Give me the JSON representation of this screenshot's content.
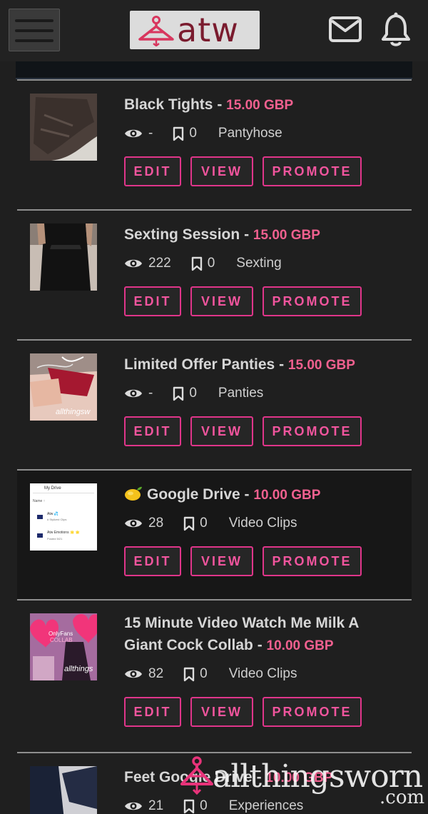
{
  "header": {
    "logo_text": "atw",
    "menu_icon": "hamburger-icon",
    "mail_icon": "mail-icon",
    "bell_icon": "bell-icon"
  },
  "listings": [
    {
      "title": "Black Tights",
      "separator": "-",
      "price": "15.00 GBP",
      "views": "-",
      "saves": "0",
      "category": "Pantyhose",
      "edit": "EDIT",
      "view": "VIEW",
      "promote": "PROMOTE"
    },
    {
      "title": "Sexting Session",
      "separator": "-",
      "price": "15.00 GBP",
      "views": "222",
      "saves": "0",
      "category": "Sexting",
      "edit": "EDIT",
      "view": "VIEW",
      "promote": "PROMOTE"
    },
    {
      "title": "Limited Offer Panties",
      "separator": "-",
      "price": "15.00 GBP",
      "views": "-",
      "saves": "0",
      "category": "Panties",
      "edit": "EDIT",
      "view": "VIEW",
      "promote": "PROMOTE",
      "thumb_caption": "allthingsw"
    },
    {
      "title": "Google Drive",
      "title_emoji": "lemon",
      "separator": "-",
      "price": "10.00 GBP",
      "views": "28",
      "saves": "0",
      "category": "Video Clips",
      "edit": "EDIT",
      "view": "VIEW",
      "promote": "PROMOTE",
      "thumb_lines": [
        "My Drive",
        "Name ↑",
        "Atw 💦",
        "# Stylized Clips",
        "Atw Emotions 🌟 🌟",
        "Posted 5/21"
      ]
    },
    {
      "title_line1": "15 Minute Video Watch Me Milk A",
      "title_line2": "Giant Cock Collab",
      "separator": "-",
      "price": "10.00 GBP",
      "views": "82",
      "saves": "0",
      "category": "Video Clips",
      "edit": "EDIT",
      "view": "VIEW",
      "promote": "PROMOTE",
      "thumb_lines": [
        "OnlyFans",
        "COLLAB",
        "allthings"
      ]
    },
    {
      "title": "Feet Google Drive",
      "separator": "-",
      "price": "10.00 GBP",
      "views": "21",
      "saves": "0",
      "category": "Experiences"
    }
  ],
  "watermark": {
    "text": "allthingsworn",
    "suffix": ".com"
  },
  "colors": {
    "accent": "#f0608f",
    "button_border": "#e0358a",
    "background": "#1f1f1f"
  }
}
